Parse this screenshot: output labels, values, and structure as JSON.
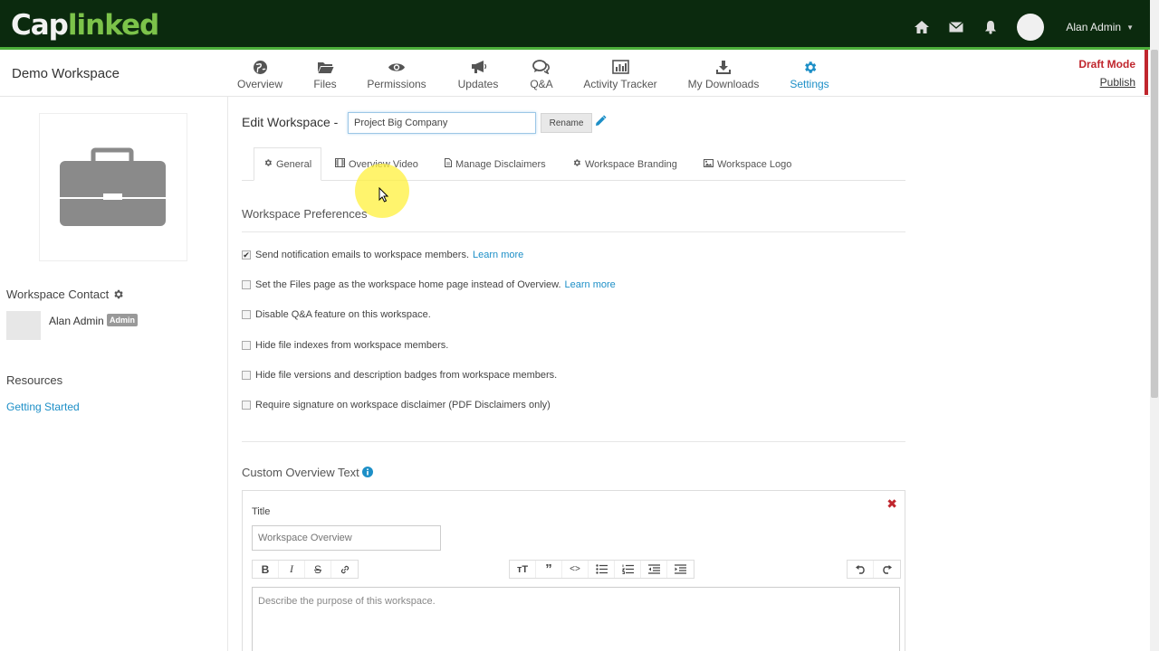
{
  "brand": {
    "logo_cap": "Cap",
    "logo_linked": "linked"
  },
  "topbar": {
    "user_name": "Alan Admin",
    "icons": [
      "home-icon",
      "envelope-icon",
      "bell-icon"
    ]
  },
  "workspace": {
    "name": "Demo Workspace"
  },
  "nav": {
    "items": [
      {
        "label": "Overview",
        "icon": "globe-icon"
      },
      {
        "label": "Files",
        "icon": "folder-icon"
      },
      {
        "label": "Permissions",
        "icon": "eye-icon"
      },
      {
        "label": "Updates",
        "icon": "megaphone-icon"
      },
      {
        "label": "Q&A",
        "icon": "comments-icon"
      },
      {
        "label": "Activity Tracker",
        "icon": "bar-chart-icon"
      },
      {
        "label": "My Downloads",
        "icon": "download-icon"
      },
      {
        "label": "Settings",
        "icon": "gear-icon",
        "active": true
      }
    ],
    "draft_mode": "Draft Mode",
    "publish": "Publish"
  },
  "sidebar": {
    "contact_heading": "Workspace Contact",
    "contact_name": "Alan Admin",
    "contact_badge": "Admin",
    "resources_heading": "Resources",
    "resources_link": "Getting Started"
  },
  "edit": {
    "label": "Edit Workspace -",
    "name_value": "Project Big Company",
    "rename_label": "Rename"
  },
  "tabs": [
    {
      "label": "General",
      "icon": "gear-icon",
      "active": true
    },
    {
      "label": "Overview Video",
      "icon": "film-icon"
    },
    {
      "label": "Manage Disclaimers",
      "icon": "file-icon"
    },
    {
      "label": "Workspace Branding",
      "icon": "gear-icon"
    },
    {
      "label": "Workspace Logo",
      "icon": "image-icon"
    }
  ],
  "preferences": {
    "title": "Workspace Preferences",
    "items": [
      {
        "text": "Send notification emails to workspace members.",
        "link": "Learn more",
        "checked": true
      },
      {
        "text": "Set the Files page as the workspace home page instead of Overview.",
        "link": "Learn more",
        "checked": false
      },
      {
        "text": "Disable Q&A feature on this workspace.",
        "checked": false
      },
      {
        "text": "Hide file indexes from workspace members.",
        "checked": false
      },
      {
        "text": "Hide file versions and description badges from workspace members.",
        "checked": false
      },
      {
        "text": "Require signature on workspace disclaimer (PDF Disclaimers only)",
        "checked": false
      }
    ]
  },
  "custom_overview": {
    "title": "Custom Overview Text",
    "field_label": "Title",
    "title_placeholder": "Workspace Overview",
    "editor_placeholder": "Describe the purpose of this workspace."
  }
}
